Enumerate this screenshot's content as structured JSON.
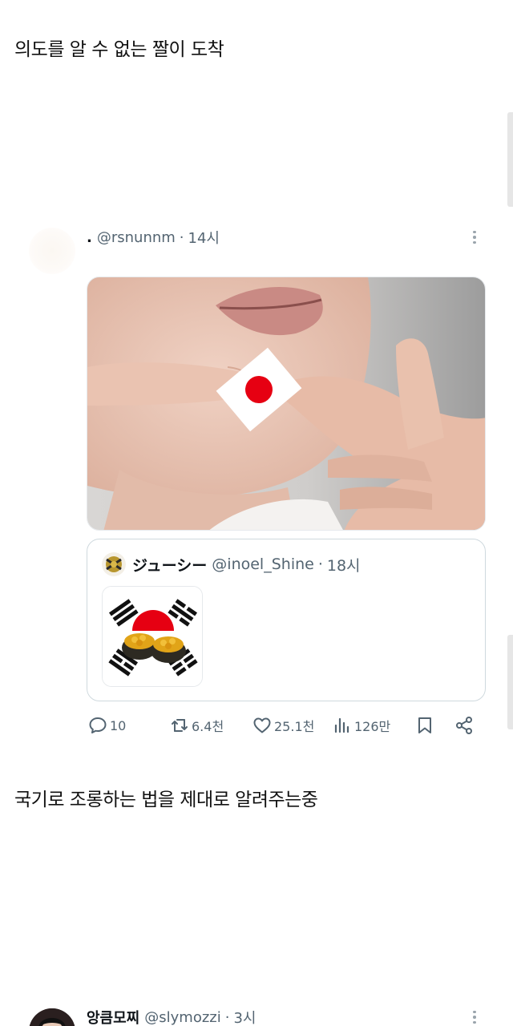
{
  "post_title": "의도를 알 수 없는 짤이 도착",
  "tweet": {
    "display_name": ".",
    "handle": "@rsnunnm",
    "separator": "·",
    "time": "14시",
    "media_icon": "japanese-flag-finger-photo",
    "quote": {
      "display_name": "ジューシー",
      "handle": "@inoel_Shine",
      "separator": "·",
      "time": "18시",
      "avatar_icon": "gold-emblem-avatar",
      "media_icon": "taegeukgi-sushi-image"
    },
    "actions": {
      "replies": "10",
      "retweets": "6.4천",
      "likes": "25.1천",
      "views": "126만"
    }
  },
  "second_caption": "국기로 조롱하는 법을 제대로 알려주는중",
  "next_tweet": {
    "display_name": "앙큼모찌",
    "handle": "@slymozzi",
    "separator": "·",
    "time": "3시"
  },
  "colors": {
    "text_primary": "#0f1419",
    "text_secondary": "#536471",
    "border": "#cfd9de",
    "flag_red": "#e60012"
  }
}
